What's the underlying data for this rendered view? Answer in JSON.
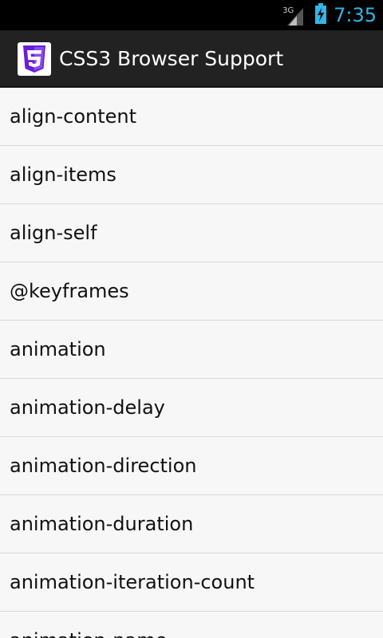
{
  "status_bar": {
    "network": "3G",
    "time": "7:35"
  },
  "action_bar": {
    "title": "CSS3 Browser Support",
    "icon": "css3-logo-icon"
  },
  "list": {
    "items": [
      "align-content",
      "align-items",
      "align-self",
      "@keyframes",
      "animation",
      "animation-delay",
      "animation-direction",
      "animation-duration",
      "animation-iteration-count",
      "animation-name"
    ]
  },
  "colors": {
    "status_bar_bg": "#000000",
    "clock": "#33b5e5",
    "action_bar_bg": "#222222",
    "list_bg": "#f7f7f7",
    "divider": "#d8d8d8",
    "css3_purple": "#6a1ed8"
  }
}
